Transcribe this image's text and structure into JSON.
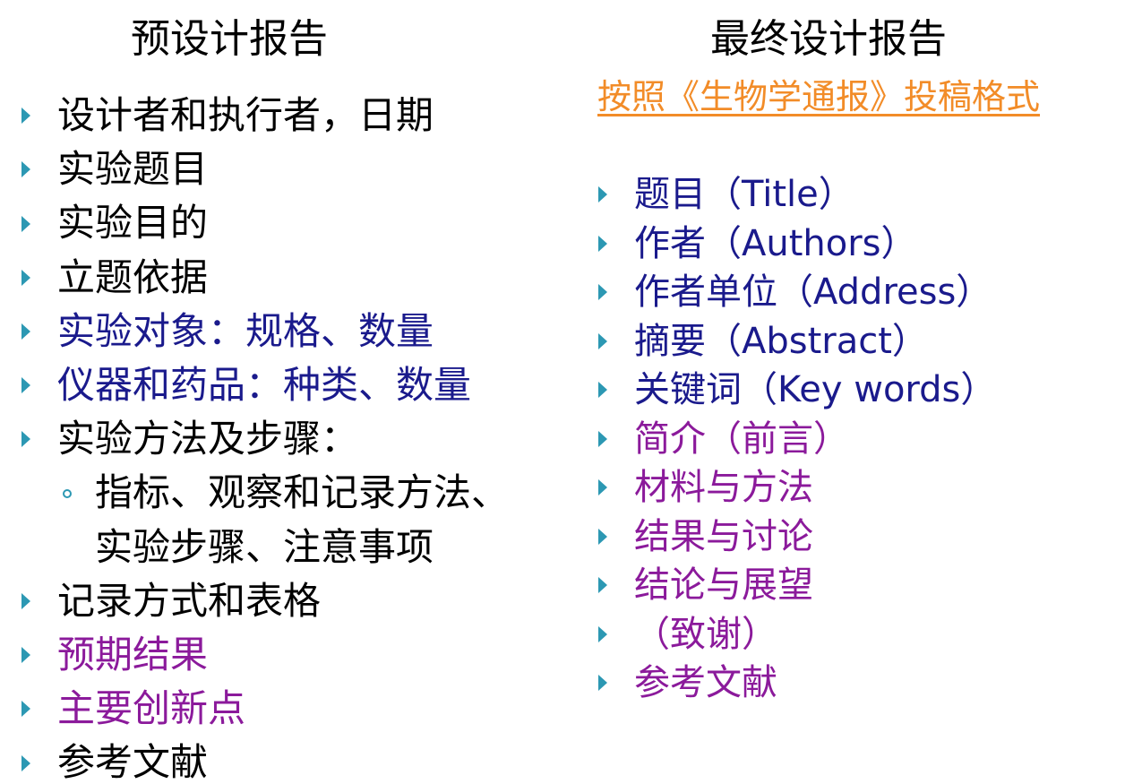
{
  "left": {
    "title": "预设计报告",
    "items": [
      {
        "text": "设计者和执行者，日期",
        "color": "#000000"
      },
      {
        "text": "实验题目",
        "color": "#000000"
      },
      {
        "text": "实验目的",
        "color": "#000000"
      },
      {
        "text": "立题依据",
        "color": "#000000"
      },
      {
        "text": "实验对象：规格、数量",
        "color": "#1a1a8c"
      },
      {
        "text": "仪器和药品：种类、数量",
        "color": "#1a1a8c"
      },
      {
        "text": "实验方法及步骤：",
        "color": "#000000"
      },
      {
        "text": "指标、观察和记录方法、",
        "color": "#000000",
        "sub": true
      },
      {
        "text": "实验步骤、注意事项",
        "color": "#000000",
        "continuation": true
      },
      {
        "text": "记录方式和表格",
        "color": "#000000"
      },
      {
        "text": "预期结果",
        "color": "#8b1a9b"
      },
      {
        "text": "主要创新点",
        "color": "#8b1a9b"
      },
      {
        "text": "参考文献",
        "color": "#000000"
      }
    ]
  },
  "right": {
    "title": "最终设计报告",
    "link": "按照《生物学通报》投稿格式",
    "items": [
      {
        "text": "题目（Title）",
        "color": "#1a1a8c"
      },
      {
        "text": "作者（Authors）",
        "color": "#1a1a8c"
      },
      {
        "text": "作者单位（Address）",
        "color": "#1a1a8c"
      },
      {
        "text": "摘要（Abstract）",
        "color": "#1a1a8c"
      },
      {
        "text": "关键词（Key words）",
        "color": "#1a1a8c"
      },
      {
        "text": "简介（前言）",
        "color": "#8b1a9b"
      },
      {
        "text": "材料与方法",
        "color": "#8b1a9b"
      },
      {
        "text": "结果与讨论",
        "color": "#8b1a9b"
      },
      {
        "text": "结论与展望",
        "color": "#8b1a9b"
      },
      {
        "text": "（致谢）",
        "color": "#8b1a9b"
      },
      {
        "text": "参考文献",
        "color": "#8b1a9b"
      }
    ]
  },
  "colors": {
    "bullet": "#2c98b3",
    "link": "#f28c28"
  }
}
